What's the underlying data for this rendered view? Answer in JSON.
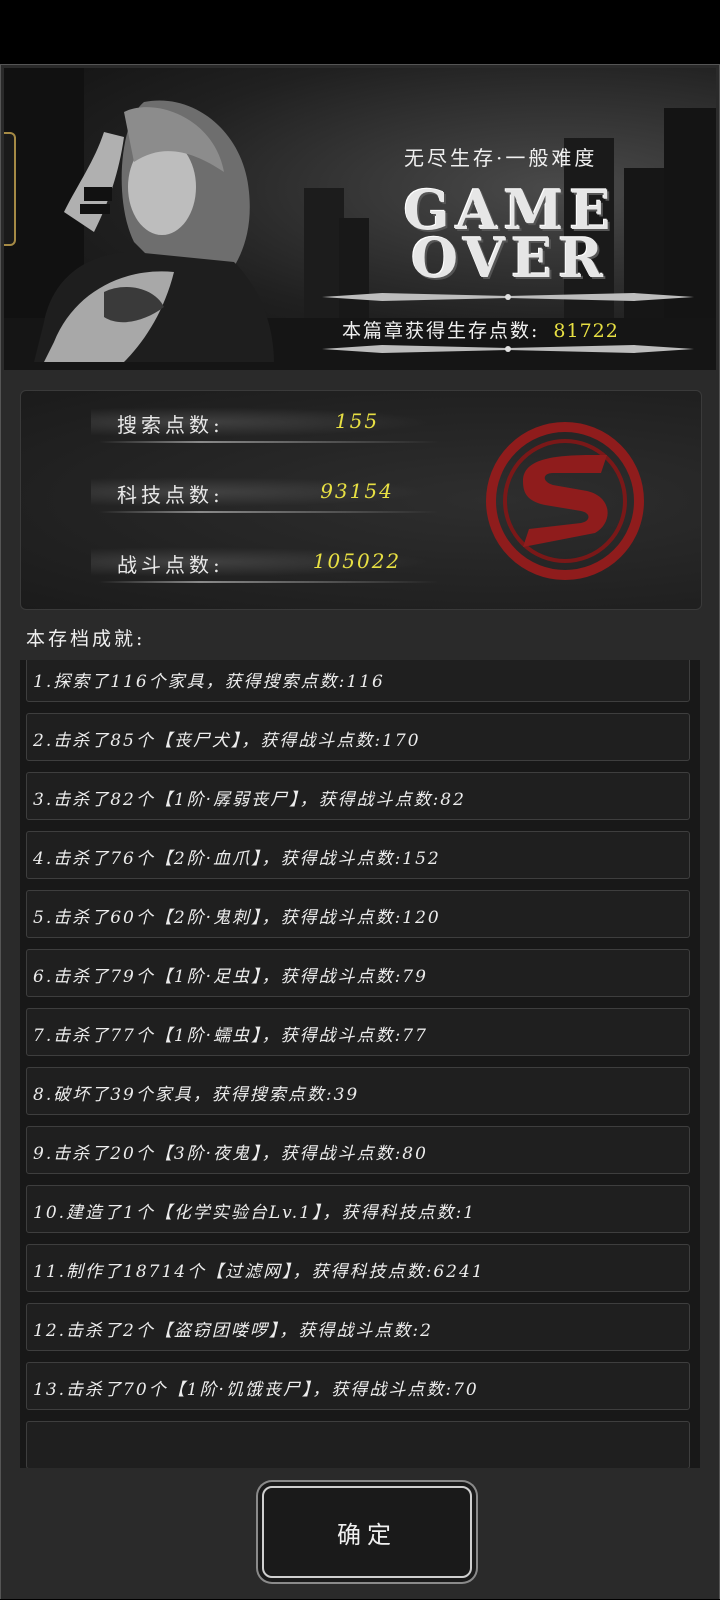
{
  "banner": {
    "mode": "无尽生存·一般难度",
    "title_line1": "GAME",
    "title_line2": "OVER",
    "points_label": "本篇章获得生存点数:",
    "points_value": "81722"
  },
  "stats": [
    {
      "label": "搜索点数:",
      "value": "155"
    },
    {
      "label": "科技点数:",
      "value": "93154"
    },
    {
      "label": "战斗点数:",
      "value": "105022"
    }
  ],
  "emblem_color": "#8f1c1c",
  "accent_yellow": "#e8e043",
  "achievements_title": "本存档成就:",
  "achievements": [
    "1.探索了116个家具，获得搜索点数:116",
    "2.击杀了85个【丧尸犬】，获得战斗点数:170",
    "3.击杀了82个【1阶·孱弱丧尸】，获得战斗点数:82",
    "4.击杀了76个【2阶·血爪】，获得战斗点数:152",
    "5.击杀了60个【2阶·鬼刺】，获得战斗点数:120",
    "6.击杀了79个【1阶·足虫】，获得战斗点数:79",
    "7.击杀了77个【1阶·蠕虫】，获得战斗点数:77",
    "8.破坏了39个家具，获得搜索点数:39",
    "9.击杀了20个【3阶·夜鬼】，获得战斗点数:80",
    "10.建造了1个【化学实验台Lv.1】，获得科技点数:1",
    "11.制作了18714个【过滤网】，获得科技点数:6241",
    "12.击杀了2个【盗窃团喽啰】，获得战斗点数:2",
    "13.击杀了70个【1阶·饥饿丧尸】，获得战斗点数:70"
  ],
  "confirm_label": "确定"
}
